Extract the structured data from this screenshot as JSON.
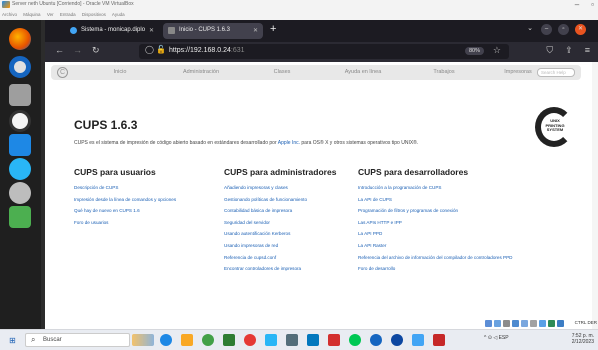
{
  "host": {
    "title": "Server neth Ubuntu [Corriendo] - Oracle VM VirtualBox",
    "menu": [
      "Archivo",
      "Máquina",
      "Ver",
      "Entrada",
      "Dispositivos",
      "Ayuda"
    ]
  },
  "browser": {
    "tabs": [
      {
        "label": "Sistema - monicap.diplo",
        "active": false
      },
      {
        "label": "Inicio - CUPS 1.6.3",
        "active": true
      }
    ],
    "url_host": "https://192.168.0.24",
    "url_port": ":631",
    "zoom": "80%"
  },
  "cups": {
    "nav": [
      "Inicio",
      "Administración",
      "Clases",
      "Ayuda en línea",
      "Trabajos",
      "Impresoras"
    ],
    "search_placeholder": "Search Help",
    "title": "CUPS 1.6.3",
    "intro_pre": "CUPS es el sistema de impresión de código abierto basado en estándares desarrollado por",
    "intro_link": "Apple Inc.",
    "intro_post": "para OS® X y otros sistemas operativos tipo UNIX®.",
    "logo_text": [
      "UNIX",
      "PRINTING",
      "SYSTEM"
    ],
    "columns": [
      {
        "heading": "CUPS para usuarios",
        "links": [
          "Descripción de CUPS",
          "Impresión desde la línea de comandos y opciones",
          "Qué hay de nuevo en CUPS 1.6",
          "Foro de usuarios"
        ]
      },
      {
        "heading": "CUPS para administradores",
        "links": [
          "Añadiendo impresoras y clases",
          "Gestionando políticas de funcionamiento",
          "Contabilidad básica de impresora",
          "Seguridad del servidor",
          "Usando autentificación Kerberos",
          "Usando impresoras de red",
          "Referencia de cupsd.conf",
          "Encontrar controladores de impresora"
        ]
      },
      {
        "heading": "CUPS para desarrolladores",
        "links": [
          "Introducción a la programación de CUPS",
          "La API de CUPS",
          "Programación de filtros y programas de conexión",
          "Las APIs HTTP e IPP",
          "La API PPD",
          "La API Raster",
          "Referencia del archivo de información del compilador de controladores PPD",
          "Foro de desarrollo"
        ]
      }
    ]
  },
  "taskbar": {
    "search_placeholder": "Buscar",
    "lang": "ESP",
    "time": "7:52 p. m.",
    "date": "2/12/2023",
    "vb_key": "CTRL DER"
  },
  "colors": {
    "link": "#1a5fb4",
    "browser_dark": "#1c1b22",
    "toolbar": "#2b2a33"
  }
}
